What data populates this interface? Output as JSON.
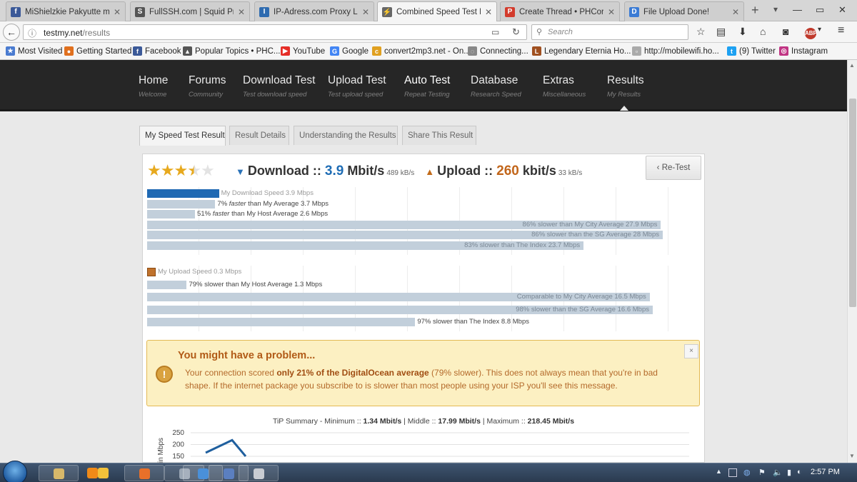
{
  "browser": {
    "tabs": [
      {
        "label": "MiShielzkie Pakyutte mess",
        "color": "#3b5998",
        "glyph": "f"
      },
      {
        "label": "FullSSH.com | Squid Proxy",
        "color": "#555555",
        "glyph": "S"
      },
      {
        "label": "IP-Adress.com Proxy List |",
        "color": "#2e6bb0",
        "glyph": "I"
      },
      {
        "label": "Combined Speed Test Res",
        "color": "#666666",
        "glyph": "⚡"
      },
      {
        "label": "Create Thread • PHCorner",
        "color": "#d33b2c",
        "glyph": "P"
      },
      {
        "label": "File Upload Done!",
        "color": "#3a7bd5",
        "glyph": "D"
      }
    ],
    "new_tab": "+",
    "url_host": "testmy.net",
    "url_path": "/results",
    "search_placeholder": "Search",
    "bookmarks": [
      {
        "label": "Most Visited",
        "color": "#4a7bd0",
        "glyph": "★"
      },
      {
        "label": "Getting Started",
        "color": "#e0701e",
        "glyph": "●"
      },
      {
        "label": "Facebook",
        "color": "#3b5998",
        "glyph": "f"
      },
      {
        "label": "Popular Topics • PHC...",
        "color": "#555555",
        "glyph": "▲"
      },
      {
        "label": "YouTube",
        "color": "#e52d27",
        "glyph": "▶"
      },
      {
        "label": "Google",
        "color": "#4285f4",
        "glyph": "G"
      },
      {
        "label": "convert2mp3.net - On...",
        "color": "#e0a020",
        "glyph": "c"
      },
      {
        "label": "Connecting...",
        "color": "#888888",
        "glyph": "◌"
      },
      {
        "label": "Legendary Eternia Ho...",
        "color": "#a05020",
        "glyph": "L"
      },
      {
        "label": "http://mobilewifi.ho...",
        "color": "#aaaaaa",
        "glyph": "▫"
      },
      {
        "label": "(9) Twitter",
        "color": "#1da1f2",
        "glyph": "t"
      },
      {
        "label": "Instagram",
        "color": "#c13584",
        "glyph": "◎"
      }
    ],
    "abp_label": "ABP"
  },
  "site_nav": [
    {
      "label": "Home",
      "sub": "Welcome"
    },
    {
      "label": "Forums",
      "sub": "Community"
    },
    {
      "label": "Download Test",
      "sub": "Test download speed"
    },
    {
      "label": "Upload Test",
      "sub": "Test upload speed"
    },
    {
      "label": "Auto Test",
      "sub": "Repeat Testing"
    },
    {
      "label": "Database",
      "sub": "Research Speed"
    },
    {
      "label": "Extras",
      "sub": "Miscellaneous"
    },
    {
      "label": "Results",
      "sub": "My Results"
    }
  ],
  "page_tabs": [
    "My Speed Test Result",
    "Result Details",
    "Understanding the Results",
    "Share This Result"
  ],
  "rating": {
    "stars": 3.5,
    "max": 5
  },
  "result": {
    "download_label": "Download ::",
    "download_value": "3.9",
    "download_unit": "Mbit/s",
    "download_kb": "489 kB/s",
    "upload_label": "Upload ::",
    "upload_value": "260",
    "upload_unit": "kbit/s",
    "upload_kb": "33 kB/s",
    "retest_label": "‹ Re-Test"
  },
  "download_compare": {
    "mine": {
      "text": "My Download Speed 3.9 Mbps",
      "value": 3.9
    },
    "rows": [
      {
        "pre": "7% ",
        "em": "faster",
        "post": " than My Average 3.7 Mbps",
        "value": 3.7
      },
      {
        "pre": "51% ",
        "em": "faster",
        "post": " than My Host Average 2.6 Mbps",
        "value": 2.6
      },
      {
        "pre": "",
        "em": "",
        "post": "86% slower than My City Average 27.9 Mbps",
        "value": 27.9
      },
      {
        "pre": "",
        "em": "",
        "post": "86% slower than the SG Average 28 Mbps",
        "value": 28
      },
      {
        "pre": "",
        "em": "",
        "post": "83% slower than The Index 23.7 Mbps",
        "value": 23.7
      }
    ]
  },
  "upload_compare": {
    "mine": {
      "text": "My Upload Speed 0.3 Mbps",
      "value": 0.3
    },
    "rows": [
      {
        "post": "79% slower than My Host Average 1.3 Mbps",
        "value": 1.3
      },
      {
        "post": "Comparable to My City Average 16.5 Mbps",
        "value": 16.5
      },
      {
        "post": "98% slower than the SG Average 16.6 Mbps",
        "value": 16.6
      },
      {
        "post": "97% slower than The Index 8.8 Mbps",
        "value": 8.8
      }
    ]
  },
  "alert": {
    "title": "You might have a problem...",
    "body_pre": "Your connection scored ",
    "body_bold": "only 21% of the DigitalOcean average",
    "body_mid": " (79% slower). This does not always mean that you're in bad shape. If the internet package you subscribe to is slower than most people using your ISP you'll see this message.",
    "close": "×",
    "icon": "!"
  },
  "tip_summary": {
    "min_label": "TiP Summary - Minimum :: ",
    "min_val": "1.34 Mbit/s",
    "mid_label": " | Middle :: ",
    "mid_val": "17.99 Mbit/s",
    "max_label": " | Maximum :: ",
    "max_val": "218.45 Mbit/s"
  },
  "chart_data": {
    "type": "line",
    "ylabel": "in Mbps",
    "yticks": [
      250,
      200,
      150
    ],
    "ylim": [
      0,
      250
    ],
    "series": [
      {
        "name": "",
        "x": [
          0,
          1,
          2
        ],
        "values": [
          165,
          218.45,
          150
        ]
      }
    ],
    "color": "#1f5f9e"
  },
  "taskbar": {
    "clock": "2:57 PM",
    "apps": [
      "#d7b86a",
      "#f08a18",
      "#f2c13a",
      "#e8702a",
      "#9aa6b4",
      "#4a90d9",
      "#5b7fc0",
      "#c9ccd2"
    ]
  }
}
